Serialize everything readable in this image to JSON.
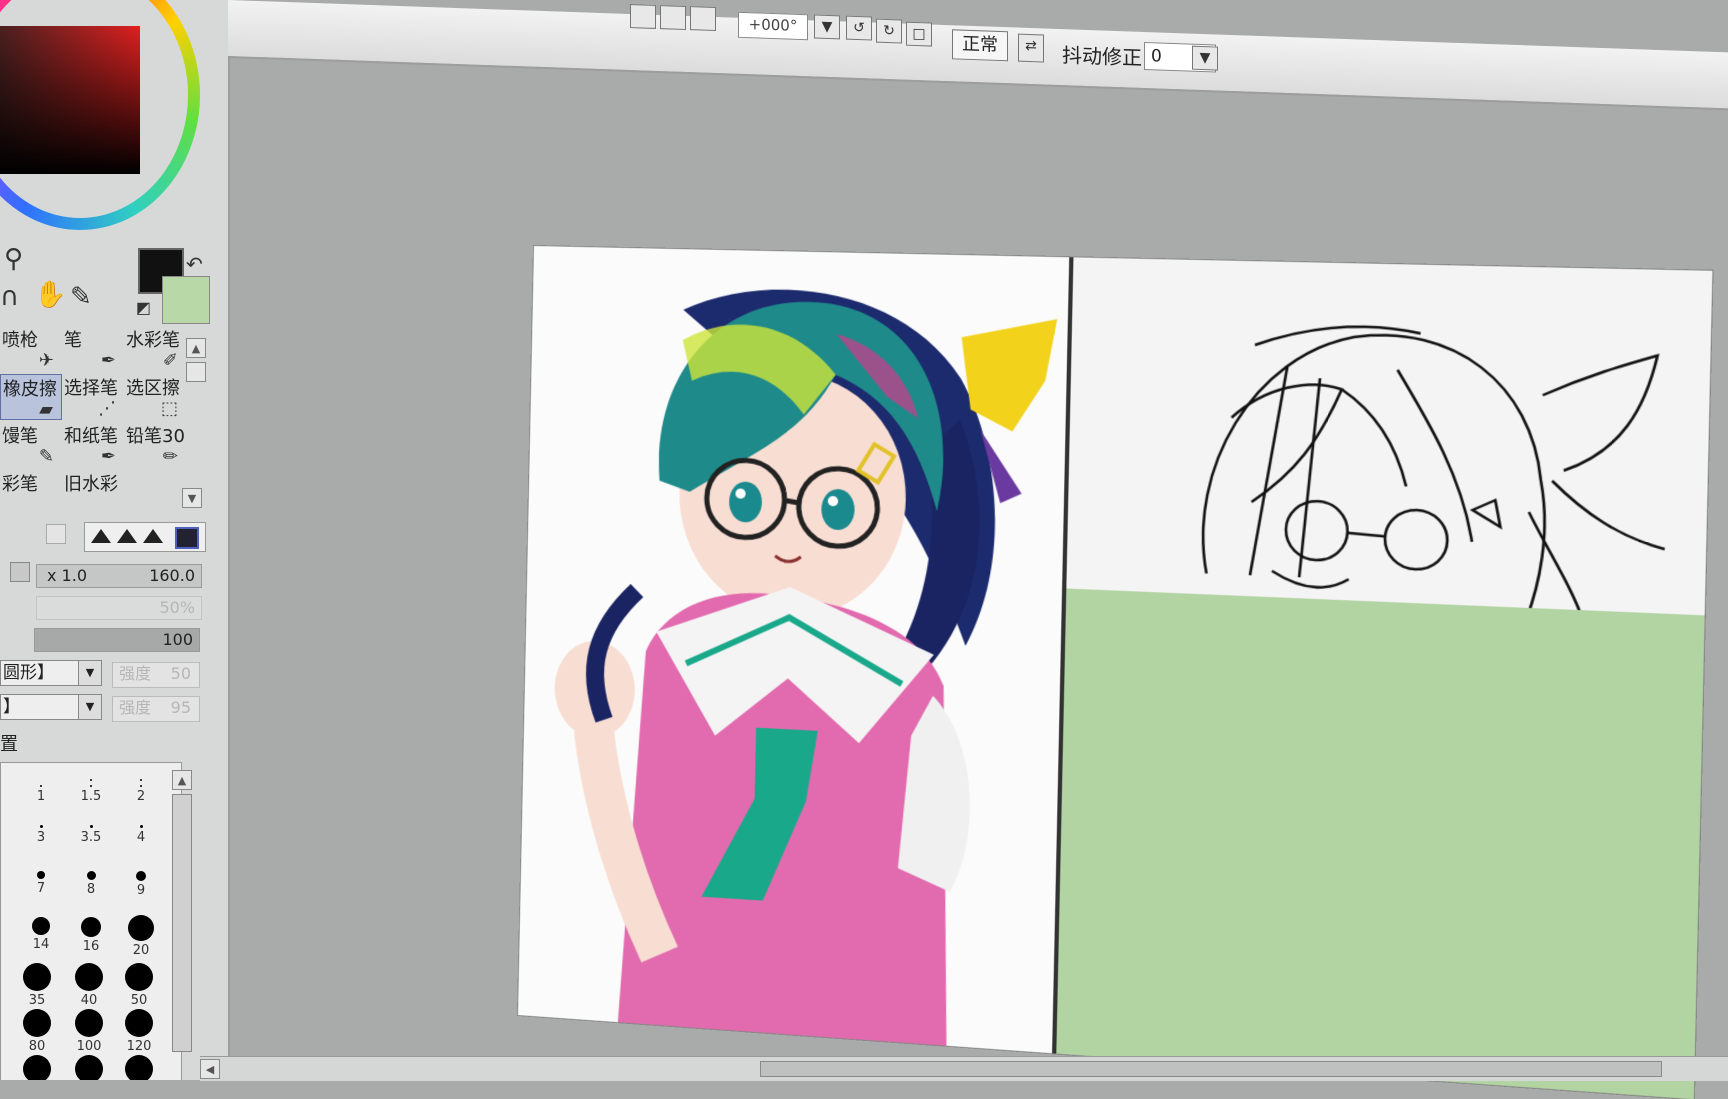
{
  "toolbar": {
    "angle_value": "+000°",
    "blend_mode": "正常",
    "stabilizer_label": "抖动修正",
    "stabilizer_value": "0"
  },
  "brushes": [
    {
      "label": "喷枪",
      "icon": "airbrush-icon"
    },
    {
      "label": "笔",
      "icon": "pen-icon"
    },
    {
      "label": "水彩笔",
      "icon": "watercolor-icon"
    },
    {
      "label": "橡皮擦",
      "icon": "eraser-icon",
      "selected": true
    },
    {
      "label": "选择笔",
      "icon": "selection-pen-icon"
    },
    {
      "label": "选区擦",
      "icon": "selection-eraser-icon"
    },
    {
      "label": "馒笔",
      "icon": "marker-icon"
    },
    {
      "label": "和纸笔",
      "icon": "washi-pen-icon"
    },
    {
      "label": "铅笔30",
      "icon": "pencil-icon"
    },
    {
      "label": "彩笔",
      "icon": "color-pen-icon"
    },
    {
      "label": "旧水彩",
      "icon": "old-watercolor-icon"
    }
  ],
  "brush_settings": {
    "size_multiplier": "x 1.0",
    "size": "160.0",
    "min_size": "50%",
    "density": "100",
    "shape": "圆形】",
    "texture": "】",
    "strength_label": "强度",
    "strength1": "50",
    "strength2": "95",
    "advanced_label": "置"
  },
  "size_presets": [
    ".",
    "1",
    "1.5",
    "2",
    "3",
    "3.5",
    "4",
    "7",
    "8",
    "9",
    "14",
    "16",
    "20",
    "35",
    "40",
    "50",
    "80",
    "100",
    "120"
  ],
  "colors": {
    "foreground": "#111111",
    "background": "#b8d8a8",
    "canvas_fill": "#b2d4a2"
  }
}
